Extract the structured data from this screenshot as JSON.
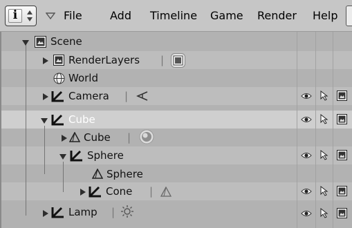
{
  "header": {
    "info_button": {
      "glyph": "i",
      "icon": "info-icon"
    },
    "menus": [
      "File",
      "Add",
      "Timeline",
      "Game",
      "Render",
      "Help"
    ]
  },
  "outliner": {
    "rows": [
      {
        "id": "scene",
        "label": "Scene",
        "expanded": true,
        "icon": "scene-icon"
      },
      {
        "id": "renderlayers",
        "label": "RenderLayers",
        "expanded": false,
        "icon": "image-icon",
        "data_icon": "render-layer-icon"
      },
      {
        "id": "world",
        "label": "World",
        "icon": "world-icon"
      },
      {
        "id": "camera",
        "label": "Camera",
        "expanded": false,
        "icon": "object-icon",
        "data_icon": "camera-icon"
      },
      {
        "id": "cube",
        "label": "Cube",
        "expanded": true,
        "icon": "object-icon",
        "selected": true
      },
      {
        "id": "cube-mesh",
        "label": "Cube",
        "expanded": false,
        "icon": "mesh-icon",
        "data_icon": "material-sphere-icon"
      },
      {
        "id": "sphere",
        "label": "Sphere",
        "expanded": true,
        "icon": "object-icon"
      },
      {
        "id": "sphere-mesh",
        "label": "Sphere",
        "icon": "mesh-icon"
      },
      {
        "id": "cone",
        "label": "Cone",
        "expanded": false,
        "icon": "object-icon",
        "data_icon": "mesh-icon"
      },
      {
        "id": "lamp",
        "label": "Lamp",
        "expanded": false,
        "icon": "object-icon",
        "data_icon": "lamp-icon"
      }
    ],
    "restrict_icons": [
      "eye-icon",
      "cursor-icon",
      "render-icon"
    ]
  },
  "colors": {
    "header_bg": "#c6c6c6",
    "outliner_bg": "#b2b2b2",
    "selected_row": "#cfcfcf",
    "selected_text": "#ffffff",
    "tree_line": "#747474"
  }
}
